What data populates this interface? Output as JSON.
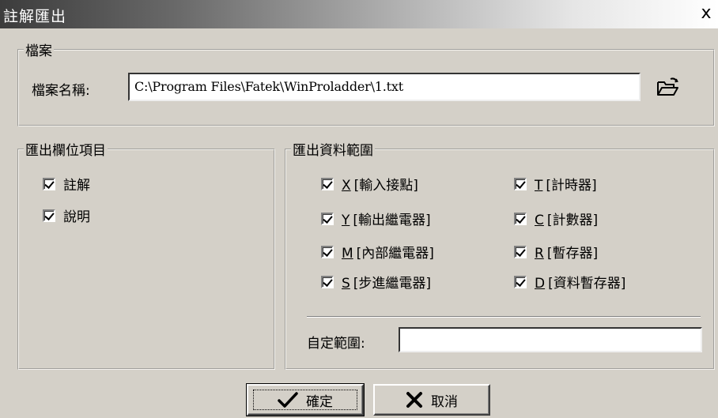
{
  "window": {
    "title": "註解匯出",
    "close_glyph": "x"
  },
  "file_group": {
    "legend": "檔案",
    "label": "檔案名稱:",
    "path": "C:\\Program Files\\Fatek\\WinProladder\\1.txt",
    "browse_icon": "folder-open-icon"
  },
  "fields_group": {
    "legend": "匯出欄位項目",
    "items": [
      {
        "label": "註解",
        "checked": true
      },
      {
        "label": "說明",
        "checked": true
      }
    ]
  },
  "range_group": {
    "legend": "匯出資料範圍",
    "left_items": [
      {
        "key": "X",
        "label": "[輸入接點]",
        "checked": true
      },
      {
        "key": "Y",
        "label": "[輸出繼電器]",
        "checked": true
      },
      {
        "key": "M",
        "label": "[內部繼電器]",
        "checked": true
      },
      {
        "key": "S",
        "label": "[步進繼電器]",
        "checked": true
      }
    ],
    "right_items": [
      {
        "key": "T",
        "label": "[計時器]",
        "checked": true
      },
      {
        "key": "C",
        "label": "[計數器]",
        "checked": true
      },
      {
        "key": "R",
        "label": "[暫存器]",
        "checked": true
      },
      {
        "key": "D",
        "label": "[資料暫存器]",
        "checked": true
      }
    ],
    "custom_label": "自定範圍:",
    "custom_value": ""
  },
  "buttons": {
    "ok_label": "確定",
    "ok_icon": "checkmark-icon",
    "cancel_label": "取消",
    "cancel_icon": "x-icon"
  }
}
